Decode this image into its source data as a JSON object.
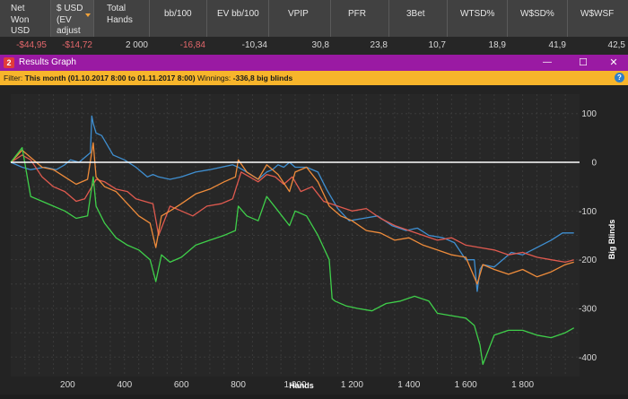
{
  "stats_table": {
    "headers": [
      "Net Won USD",
      "$ USD (EV adjust",
      "Total Hands",
      "bb/100",
      "EV bb/100",
      "VPIP",
      "PFR",
      "3Bet",
      "WTSD%",
      "W$SD%",
      "W$WSF"
    ],
    "header_lines": [
      [
        "Net",
        "Won",
        "USD"
      ],
      [
        "$ USD",
        "(EV",
        "adjust"
      ],
      [
        "Total",
        "Hands"
      ],
      [
        "bb/100"
      ],
      [
        "EV bb/100"
      ],
      [
        "VPIP"
      ],
      [
        "PFR"
      ],
      [
        "3Bet"
      ],
      [
        "WTSD%"
      ],
      [
        "W$SD%"
      ],
      [
        "W$WSF"
      ]
    ],
    "row": [
      "-$44,95",
      "-$14,72",
      "2 000",
      "-16,84",
      "-10,34",
      "30,8",
      "23,8",
      "10,7",
      "18,9",
      "41,9",
      "42,5"
    ],
    "negative_color": "#e3676b",
    "sort_arrow_color": "#f2a33a"
  },
  "window": {
    "title": "Results Graph",
    "icon_label": "2",
    "titlebar_color": "#9a1aa3",
    "controls": {
      "minimize": "—",
      "maximize": "☐",
      "close": "✕"
    }
  },
  "filter_bar": {
    "filter_label": "Filter:",
    "filter_value": "This month (01.10.2017 8:00 to 01.11.2017 8:00)",
    "winnings_label": "Winnings:",
    "winnings_value": "-336,8 big blinds",
    "help_label": "?",
    "color": "#f7b52b"
  },
  "chart_data": {
    "type": "line",
    "xlabel": "Hands",
    "ylabel": "Big Blinds",
    "xlim": [
      0,
      2000
    ],
    "ylim": [
      -440,
      140
    ],
    "x_ticks": [
      200,
      400,
      600,
      800,
      1000,
      1200,
      1400,
      1600,
      1800
    ],
    "x_tick_labels": [
      "200",
      "400",
      "600",
      "800",
      "1 000",
      "1 200",
      "1 400",
      "1 600",
      "1 800"
    ],
    "y_ticks": [
      100,
      0,
      -100,
      -200,
      -300,
      -400
    ],
    "y_tick_labels": [
      "100",
      "0",
      "-100",
      "-200",
      "-300",
      "-400"
    ],
    "grid": true,
    "zero_line": true,
    "series": [
      {
        "color": "#3f8fd1",
        "x": [
          0,
          40,
          70,
          120,
          160,
          190,
          210,
          240,
          280,
          285,
          290,
          300,
          320,
          360,
          400,
          440,
          480,
          500,
          520,
          560,
          600,
          650,
          700,
          740,
          780,
          800,
          830,
          870,
          900,
          920,
          940,
          960,
          980,
          1000,
          1040,
          1080,
          1110,
          1150,
          1190,
          1240,
          1290,
          1340,
          1390,
          1430,
          1470,
          1520,
          1560,
          1600,
          1630,
          1640,
          1650,
          1660,
          1700,
          1760,
          1800,
          1850,
          1900,
          1940,
          1980
        ],
        "y": [
          0,
          -10,
          -15,
          -10,
          -15,
          -5,
          5,
          0,
          20,
          95,
          80,
          60,
          55,
          15,
          5,
          -10,
          -30,
          -25,
          -30,
          -35,
          -30,
          -20,
          -15,
          -10,
          -5,
          -10,
          -20,
          -35,
          -20,
          -15,
          -5,
          -10,
          0,
          -10,
          -10,
          -20,
          -55,
          -95,
          -120,
          -115,
          -110,
          -130,
          -140,
          -135,
          -150,
          -155,
          -165,
          -200,
          -200,
          -265,
          -220,
          -210,
          -215,
          -185,
          -190,
          -175,
          -160,
          -145,
          -145
        ]
      },
      {
        "color": "#e05a4f",
        "x": [
          0,
          40,
          70,
          110,
          150,
          190,
          230,
          260,
          300,
          330,
          370,
          410,
          440,
          470,
          500,
          520,
          560,
          600,
          640,
          690,
          740,
          780,
          810,
          840,
          870,
          900,
          930,
          960,
          990,
          1020,
          1060,
          1100,
          1150,
          1200,
          1250,
          1300,
          1350,
          1400,
          1450,
          1500,
          1550,
          1600,
          1650,
          1700,
          1750,
          1800,
          1850,
          1900,
          1950,
          1980
        ],
        "y": [
          0,
          15,
          5,
          -30,
          -50,
          -60,
          -80,
          -75,
          -35,
          -40,
          -55,
          -60,
          -75,
          -80,
          -85,
          -150,
          -90,
          -100,
          -110,
          -90,
          -85,
          -75,
          -20,
          -30,
          -40,
          -25,
          -30,
          -45,
          -30,
          -60,
          -50,
          -80,
          -90,
          -100,
          -95,
          -115,
          -130,
          -140,
          -150,
          -160,
          -155,
          -170,
          -175,
          -180,
          -190,
          -185,
          -195,
          -200,
          -205,
          -200
        ]
      },
      {
        "color": "#ef8c3b",
        "x": [
          0,
          40,
          70,
          110,
          150,
          190,
          230,
          270,
          290,
          300,
          330,
          370,
          410,
          450,
          490,
          510,
          530,
          560,
          600,
          650,
          700,
          750,
          790,
          800,
          830,
          870,
          900,
          940,
          980,
          1000,
          1040,
          1080,
          1120,
          1160,
          1200,
          1250,
          1300,
          1350,
          1400,
          1450,
          1500,
          1550,
          1600,
          1640,
          1660,
          1700,
          1750,
          1800,
          1850,
          1900,
          1950,
          1980
        ],
        "y": [
          0,
          25,
          10,
          -10,
          -15,
          -30,
          -45,
          -35,
          40,
          -30,
          -50,
          -60,
          -85,
          -110,
          -125,
          -175,
          -110,
          -100,
          -85,
          -65,
          -55,
          -40,
          -30,
          5,
          -20,
          -35,
          -5,
          -25,
          -60,
          -20,
          -10,
          -40,
          -90,
          -110,
          -120,
          -140,
          -145,
          -160,
          -155,
          -170,
          -180,
          -190,
          -195,
          -250,
          -210,
          -220,
          -230,
          -220,
          -235,
          -225,
          -210,
          -205
        ]
      },
      {
        "color": "#3fcf4a",
        "x": [
          0,
          40,
          70,
          110,
          150,
          190,
          230,
          270,
          290,
          300,
          330,
          370,
          410,
          450,
          490,
          510,
          530,
          560,
          600,
          650,
          700,
          750,
          790,
          800,
          830,
          870,
          900,
          940,
          980,
          1000,
          1040,
          1080,
          1120,
          1130,
          1140,
          1180,
          1220,
          1270,
          1320,
          1370,
          1420,
          1470,
          1500,
          1550,
          1600,
          1630,
          1650,
          1660,
          1700,
          1750,
          1800,
          1850,
          1900,
          1950,
          1980
        ],
        "y": [
          0,
          30,
          -70,
          -80,
          -90,
          -100,
          -115,
          -110,
          -30,
          -90,
          -125,
          -155,
          -170,
          -180,
          -200,
          -245,
          -190,
          -205,
          -195,
          -170,
          -160,
          -150,
          -140,
          -90,
          -110,
          -120,
          -70,
          -100,
          -130,
          -100,
          -110,
          -150,
          -200,
          -280,
          -285,
          -295,
          -300,
          -305,
          -290,
          -285,
          -275,
          -285,
          -310,
          -315,
          -320,
          -335,
          -375,
          -415,
          -355,
          -345,
          -345,
          -355,
          -360,
          -350,
          -340
        ]
      }
    ]
  }
}
